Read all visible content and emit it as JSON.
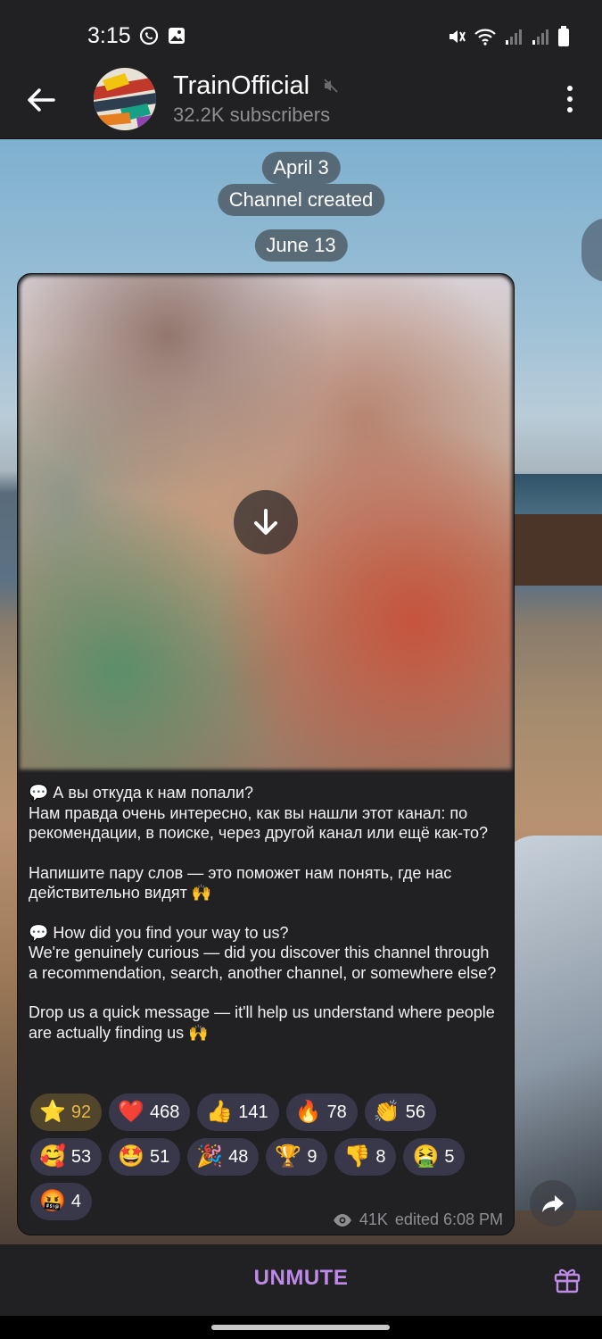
{
  "status_bar": {
    "time": "3:15",
    "left_icons": [
      "whatsapp-icon",
      "gallery-icon"
    ],
    "right_icons": [
      "mute-vibrate-icon",
      "wifi-icon",
      "signal-icon",
      "signal-icon",
      "battery-icon"
    ]
  },
  "header": {
    "channel_name": "TrainOfficial",
    "subscribers": "32.2K subscribers",
    "muted": true
  },
  "dates": {
    "first": "April 3",
    "service": "Channel created",
    "second": "June 13"
  },
  "post": {
    "paragraphs": [
      "💬 А вы откуда к нам попали?\nНам правда очень интересно, как вы нашли этот канал: по рекомендации, в поиске, через другой канал или ещё как-то?",
      "Напишите пару слов — это поможет нам понять, где нас действительно видят 🙌",
      "💬 How did you find your way to us?\nWe're genuinely curious — did you discover this channel through a recommendation, search, another channel, or somewhere else?",
      "Drop us a quick message — it'll help us understand where people are actually finding us 🙌"
    ],
    "reactions": [
      {
        "emoji": "⭐",
        "count": "92",
        "active": true
      },
      {
        "emoji": "❤️",
        "count": "468"
      },
      {
        "emoji": "👍",
        "count": "141"
      },
      {
        "emoji": "🔥",
        "count": "78"
      },
      {
        "emoji": "👏",
        "count": "56"
      },
      {
        "emoji": "🥰",
        "count": "53"
      },
      {
        "emoji": "🤩",
        "count": "51"
      },
      {
        "emoji": "🎉",
        "count": "48"
      },
      {
        "emoji": "🏆",
        "count": "9"
      },
      {
        "emoji": "👎",
        "count": "8"
      },
      {
        "emoji": "🤮",
        "count": "5"
      },
      {
        "emoji": "🤬",
        "count": "4"
      }
    ],
    "views": "41K",
    "edited": "edited 6:08 PM"
  },
  "bottom_bar": {
    "unmute_label": "UNMUTE"
  },
  "colors": {
    "accent": "#bd8be6",
    "star_active": "#e6b64a",
    "bubble": "#212124",
    "bar": "#212123"
  }
}
